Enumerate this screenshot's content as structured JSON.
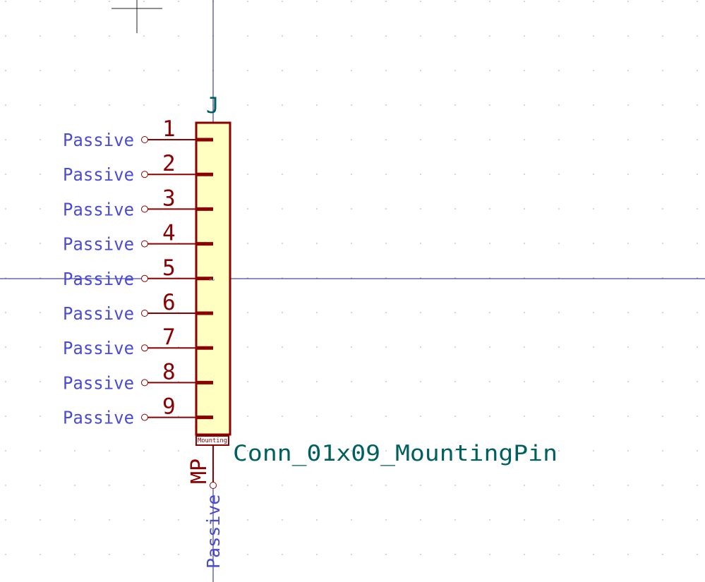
{
  "symbol": {
    "reference": "J",
    "value": "Conn_01x09_MountingPin",
    "mounting_text": "Mounting",
    "mounting_pin": {
      "number": "MP",
      "type": "Passive"
    },
    "pins": [
      {
        "number": "1",
        "type": "Passive"
      },
      {
        "number": "2",
        "type": "Passive"
      },
      {
        "number": "3",
        "type": "Passive"
      },
      {
        "number": "4",
        "type": "Passive"
      },
      {
        "number": "5",
        "type": "Passive"
      },
      {
        "number": "6",
        "type": "Passive"
      },
      {
        "number": "7",
        "type": "Passive"
      },
      {
        "number": "8",
        "type": "Passive"
      },
      {
        "number": "9",
        "type": "Passive"
      }
    ]
  },
  "colors": {
    "background": "#ffffff",
    "grid_dot": "#b8b8b8",
    "axis": "#1a1a8c",
    "symbol_outline": "#8b0000",
    "symbol_fill": "#ffffc2",
    "pin": "#8b0000",
    "pin_type_text": "#4a4ad8",
    "reference_text": "#006060",
    "value_text": "#006060"
  }
}
